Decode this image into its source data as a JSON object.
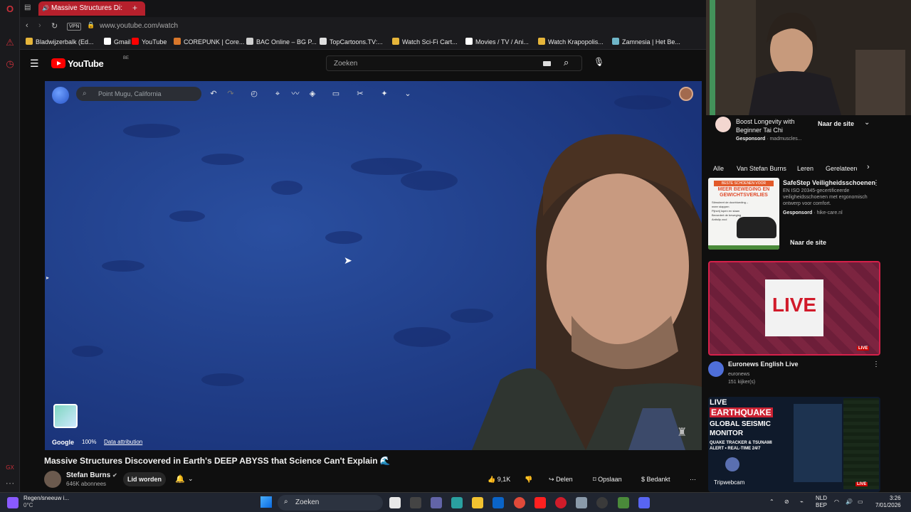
{
  "browser": {
    "active_tab_title": "Massive Structures Di:",
    "new_tab_symbol": "+",
    "vpn_label": "VPN",
    "url": "www.youtube.com/watch",
    "bookmarks": [
      {
        "label": "Bladwijzerbalk (Ed...",
        "color": "#e6b53a"
      },
      {
        "label": "Gmail",
        "color": "#ffffff"
      },
      {
        "label": "YouTube",
        "color": "#ff0000"
      },
      {
        "label": "COREPUNK | Core...",
        "color": "#d9772b"
      },
      {
        "label": "BAC Online – BG P...",
        "color": "#cfcfcf"
      },
      {
        "label": "TopCartoons.TV:...",
        "color": "#e0e0e0"
      },
      {
        "label": "Watch Sci-Fi Cart...",
        "color": "#e6b53a"
      },
      {
        "label": "Movies / TV / Ani...",
        "color": "#ffffff"
      },
      {
        "label": "Watch Krapopolis...",
        "color": "#e6b53a"
      },
      {
        "label": "Zamnesia | Het Be...",
        "color": "#6fb6c8"
      }
    ]
  },
  "youtube": {
    "logo_text": "YouTube",
    "country_code": "BE",
    "search_placeholder": "Zoeken"
  },
  "video": {
    "earth_search_placeholder": "Point Mugu, California",
    "google_label": "Google",
    "zoom_label": "100%",
    "data_attribution": "Data attribution",
    "title": "Massive Structures Discovered in Earth's DEEP ABYSS that Science Can't Explain 🌊",
    "channel_name": "Stefan Burns",
    "subscribers": "646K abonnees",
    "join_label": "Lid worden",
    "like_count": "9,1K",
    "share_label": "Delen",
    "save_label": "Opslaan",
    "thanks_label": "Bedankt"
  },
  "sidebar": {
    "ad1": {
      "title": "Boost Longevity with Beginner Tai Chi",
      "sponsored": "Gesponsord",
      "source": "· madmuscles...",
      "cta": "Naar de site"
    },
    "chips": [
      "Alle",
      "Van Stefan Burns",
      "Leren",
      "Gerelateerd"
    ],
    "ad2": {
      "title": "SafeStep Veiligheidsschoenen",
      "desc": "EN ISO 20345-gecertificeerde veiligheidsschoenen met ergonomisch ontwerp voor comfort.",
      "sponsored": "Gesponsord",
      "source": "· hike-care.nl",
      "cta": "Naar de site",
      "thumb_banner": "BESTE SCHOENEN VOOR",
      "thumb_headline": "MEER BEWEGING EN GEWICHTSVERLIES",
      "thumb_bullets": [
        "Stimuleert de doorbloeding – meer stappen",
        "Pijnvrij lopen en staan",
        "Bevordert de beweging",
        "Antislip zool"
      ]
    },
    "live1": {
      "thumb_text": "LIVE",
      "badge": "LIVE",
      "title": "Euronews English Live",
      "channel": "euronews",
      "viewers": "151 kijker(s)"
    },
    "live2": {
      "thumb_line1": "LIVE",
      "thumb_line2": "EARTHQUAKE",
      "thumb_line3": "GLOBAL SEISMIC",
      "thumb_line4": "MONITOR",
      "thumb_line5": "QUAKE TRACKER & TSUNAMI",
      "thumb_line6": "ALERT • REAL-TIME 24/7",
      "brand": "Tripwebcam",
      "badge": "LIVE"
    }
  },
  "taskbar": {
    "weather_text": "Regen/sneeuw i...",
    "weather_temp": "0°C",
    "search_placeholder": "Zoeken",
    "lang_line1": "NLD",
    "lang_line2": "BEP",
    "time": "3:26",
    "date": "7/01/2026"
  }
}
